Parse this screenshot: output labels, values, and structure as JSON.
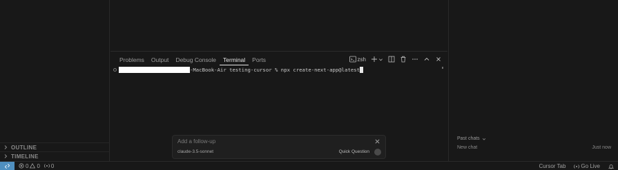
{
  "sidebar": {
    "sections": [
      {
        "label": "OUTLINE"
      },
      {
        "label": "TIMELINE"
      }
    ]
  },
  "panel": {
    "tabs": [
      {
        "label": "Problems"
      },
      {
        "label": "Output"
      },
      {
        "label": "Debug Console"
      },
      {
        "label": "Terminal"
      },
      {
        "label": "Ports"
      }
    ],
    "active_tab": "Terminal",
    "shell_label": "zsh",
    "terminal": {
      "prompt_suffix": "-MacBook-Air testing-cursor % ",
      "command": "npx create-next-app@latest"
    }
  },
  "followup": {
    "placeholder": "Add a follow-up",
    "model": "claude-3.5-sonnet",
    "quick_question": "Quick Question"
  },
  "chat": {
    "past_chats": "Past chats",
    "new_chat": "New chat",
    "time": "Just now"
  },
  "statusbar": {
    "errors": "0",
    "warnings": "0",
    "ports": "0",
    "cursor_tab": "Cursor Tab",
    "go_live": "Go Live"
  },
  "colors": {
    "background": "#181818",
    "remote_accent": "#4f8fbf",
    "active_tab": "#e7e7e7"
  }
}
